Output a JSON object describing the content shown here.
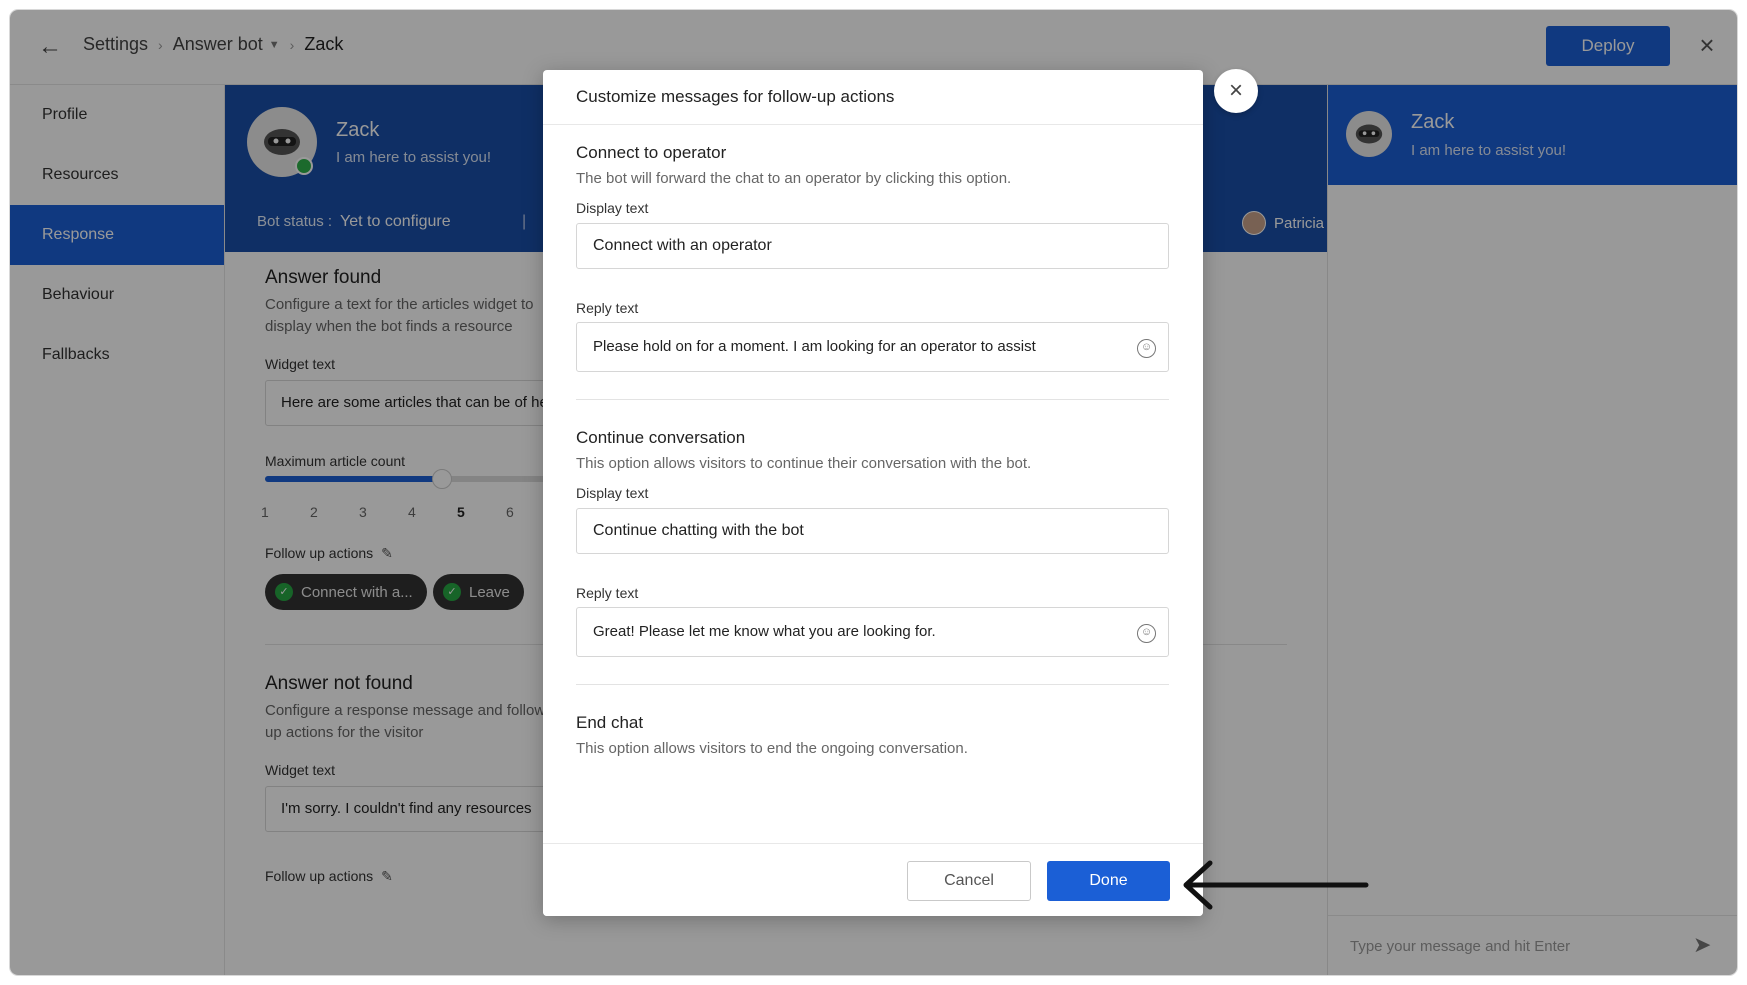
{
  "topbar": {
    "breadcrumb": [
      "Settings",
      "Answer bot",
      "Zack"
    ],
    "deploy_label": "Deploy"
  },
  "sidebar": {
    "items": [
      {
        "label": "Profile",
        "active": false
      },
      {
        "label": "Resources",
        "active": false
      },
      {
        "label": "Response",
        "active": true
      },
      {
        "label": "Behaviour",
        "active": false
      },
      {
        "label": "Fallbacks",
        "active": false
      }
    ]
  },
  "hero": {
    "bot_name": "Zack",
    "bot_tagline": "I am here to assist you!",
    "status_label": "Bot status :",
    "status_value": "Yet to configure",
    "operator_name": "Patricia"
  },
  "answer_found": {
    "title": "Answer found",
    "description": "Configure a text for the articles widget to display when the bot finds a resource",
    "widget_label": "Widget text",
    "widget_value": "Here are some articles that can be of help",
    "max_count_label": "Maximum article count",
    "ticks": [
      "1",
      "2",
      "3",
      "4",
      "5",
      "6"
    ],
    "selected_count": 5,
    "slider_fraction": 0.59,
    "follow_up_label": "Follow up actions",
    "chips": [
      "Connect with a...",
      "Leave"
    ]
  },
  "answer_not_found": {
    "title": "Answer not found",
    "description": "Configure a response message and follow up actions for the visitor",
    "widget_label": "Widget text",
    "widget_value": "I'm sorry. I couldn't find any resources",
    "follow_up_label": "Follow up actions"
  },
  "chat": {
    "bot_name": "Zack",
    "bot_tagline": "I am here to assist you!",
    "input_placeholder": "Type your message and hit Enter"
  },
  "modal": {
    "title": "Customize messages for follow-up actions",
    "sections": [
      {
        "title": "Connect to operator",
        "description": "The bot will forward the chat to an operator by clicking this option.",
        "display_label": "Display text",
        "display_value": "Connect with an operator",
        "reply_label": "Reply text",
        "reply_value": "Please hold on for a moment. I am looking for an operator to assist"
      },
      {
        "title": "Continue conversation",
        "description": "This option allows visitors to continue their conversation with the bot.",
        "display_label": "Display text",
        "display_value": "Continue chatting with the bot",
        "reply_label": "Reply text",
        "reply_value": "Great! Please let me know what you are looking for."
      },
      {
        "title": "End chat",
        "description": "This option allows visitors to end the ongoing conversation."
      }
    ],
    "cancel_label": "Cancel",
    "done_label": "Done"
  },
  "colors": {
    "accent": "#1b5fd6",
    "hero_bg": "#1a4fa8",
    "online": "#2fb14a",
    "chip_bg": "#333333"
  }
}
